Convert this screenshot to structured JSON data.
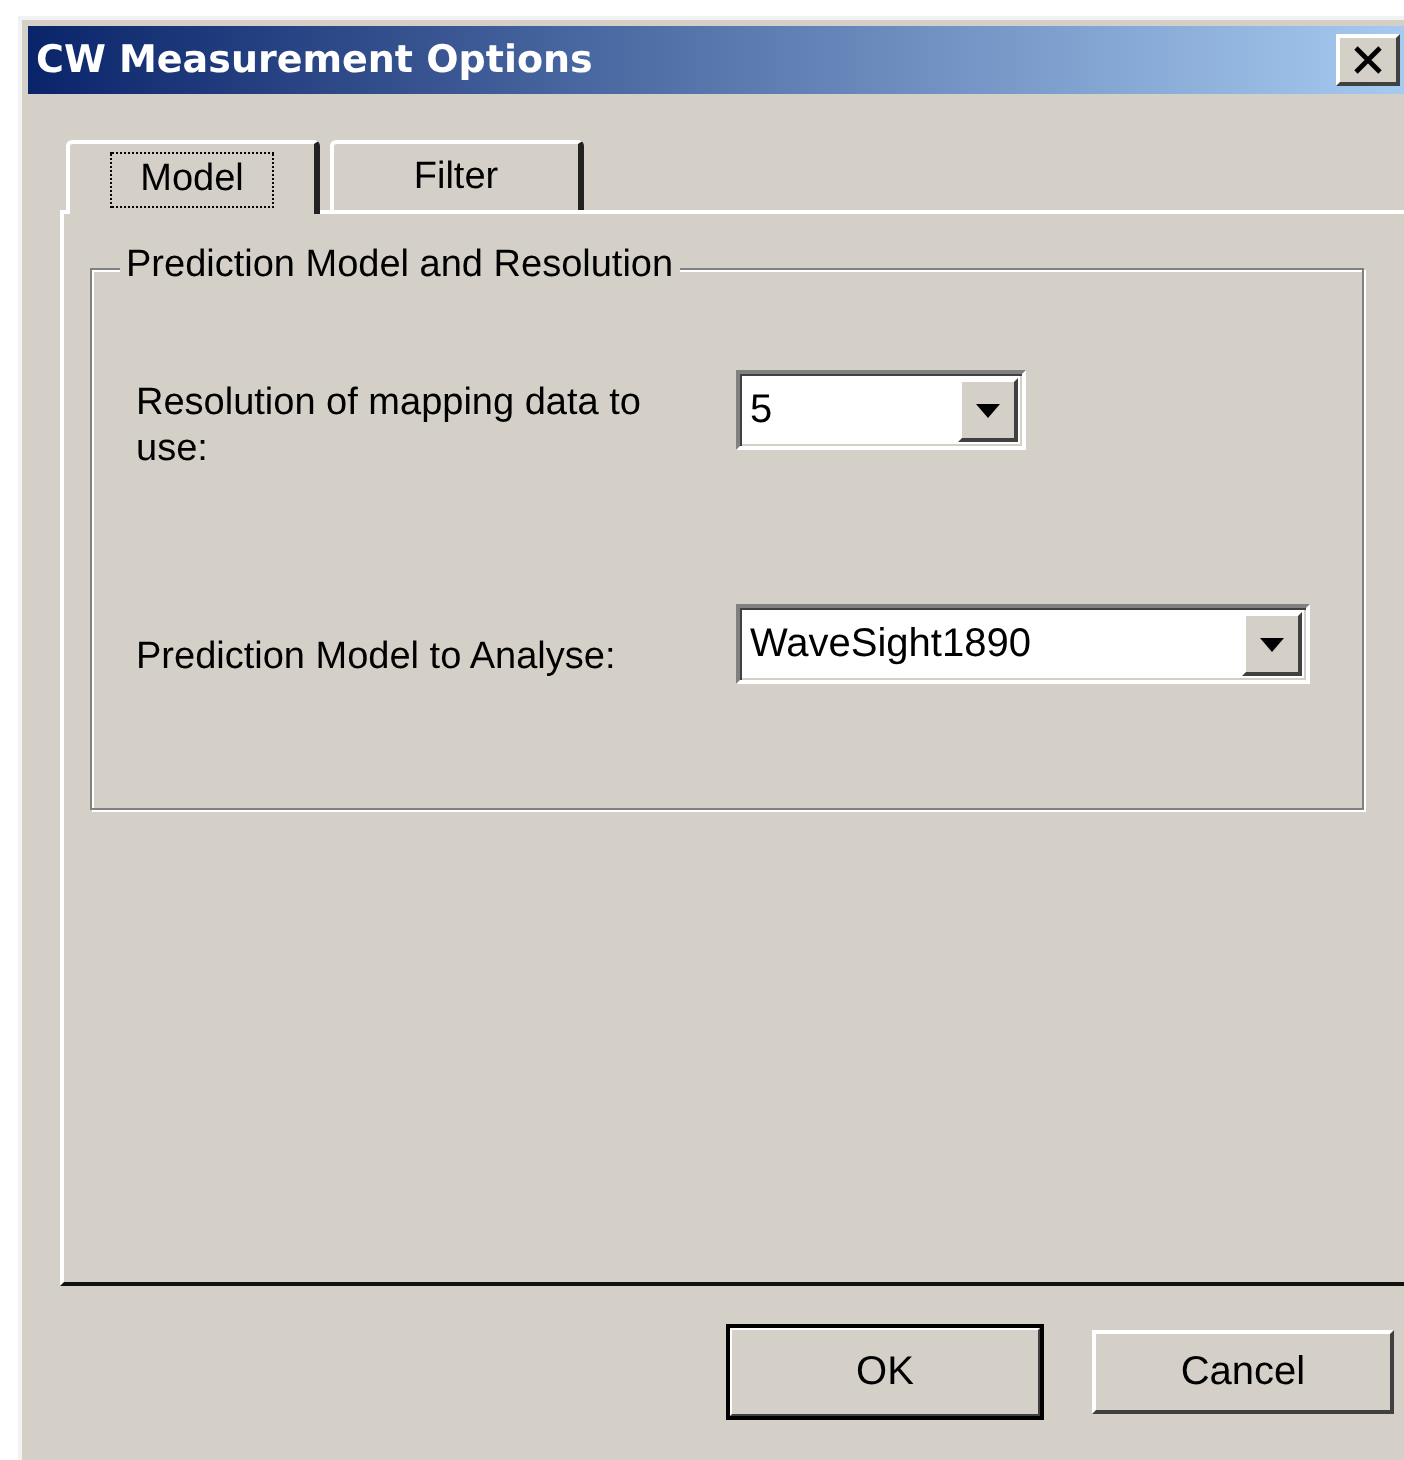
{
  "window": {
    "title": "CW Measurement Options"
  },
  "tabs": [
    {
      "label": "Model",
      "selected": true
    },
    {
      "label": "Filter",
      "selected": false
    }
  ],
  "group": {
    "title": "Prediction Model and Resolution",
    "fields": [
      {
        "label": "Resolution of mapping data to use:",
        "value": "5"
      },
      {
        "label": "Prediction Model to Analyse:",
        "value": "WaveSight1890"
      }
    ]
  },
  "buttons": [
    {
      "label": "OK",
      "default": true
    },
    {
      "label": "Cancel",
      "default": false
    }
  ]
}
